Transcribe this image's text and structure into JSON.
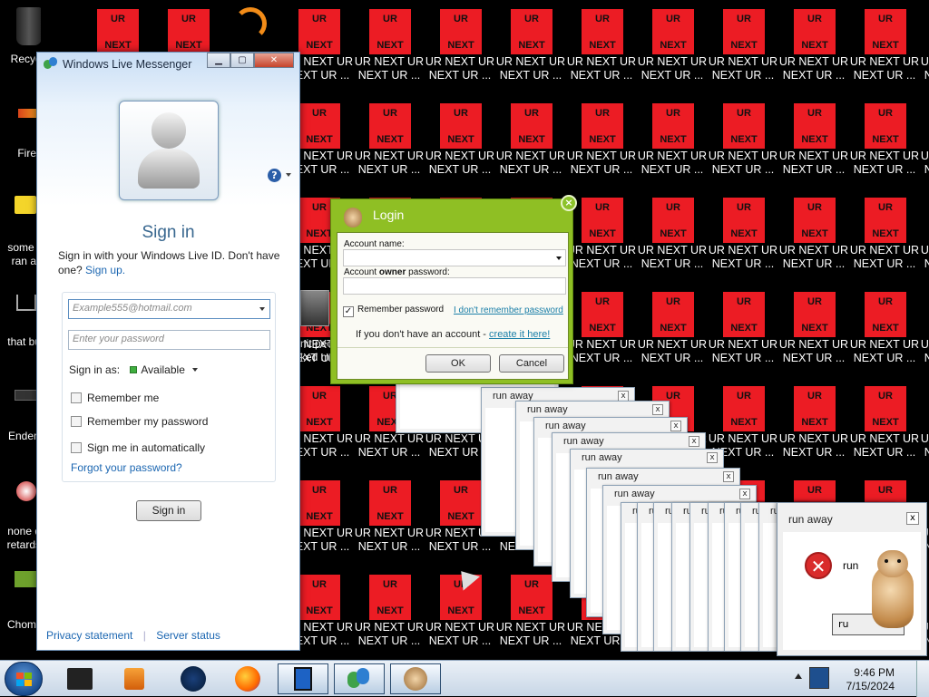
{
  "desktop": {
    "tile_top": "UR",
    "tile_bottom": "NEXT",
    "icon_caption_1": "UR NEXT UR",
    "icon_caption_2": "NEXT UR ...",
    "left_icons": [
      {
        "label": "Recyc"
      },
      {
        "label": "Fire"
      },
      {
        "label": "some r",
        "label2": "ran a"
      },
      {
        "label": "that bu"
      },
      {
        "label": "Enderr"
      },
      {
        "label": "none d",
        "label2": "retards"
      },
      {
        "label": "Chom"
      }
    ],
    "partial_icon": {
      "label": "nit peo",
      "label2": "ked m"
    }
  },
  "wlm": {
    "title": "Windows Live Messenger",
    "heading": "Sign in",
    "intro": "Sign in with your Windows Live ID. Don't have one?",
    "signup": "Sign up.",
    "email_placeholder": "Example555@hotmail.com",
    "password_placeholder": "Enter your password",
    "sign_in_as_label": "Sign in as:",
    "status": "Available",
    "remember_me": "Remember me",
    "remember_password": "Remember my password",
    "sign_in_auto": "Sign me in automatically",
    "forgot": "Forgot your password?",
    "sign_in_button": "Sign in",
    "privacy": "Privacy statement",
    "server_status": "Server status",
    "help": "?"
  },
  "login": {
    "title": "Login",
    "account_name_label": "Account name:",
    "password_label_pre": "Account ",
    "password_label_bold": "owner",
    "password_label_post": " password:",
    "remember_password": "Remember password",
    "forgot_link": "I don't remember password",
    "no_account_text": "If you don't have an account - ",
    "create_link": "create it here!",
    "ok": "OK",
    "cancel": "Cancel"
  },
  "runaway": {
    "title": "run away",
    "message": "run",
    "button": "ru",
    "close": "x"
  },
  "taskbar": {
    "time": "9:46 PM",
    "date": "7/15/2024"
  },
  "colors": {
    "tile_red": "#ec1c24",
    "login_green": "#8fbf24",
    "wlm_blue": "#38678f"
  }
}
